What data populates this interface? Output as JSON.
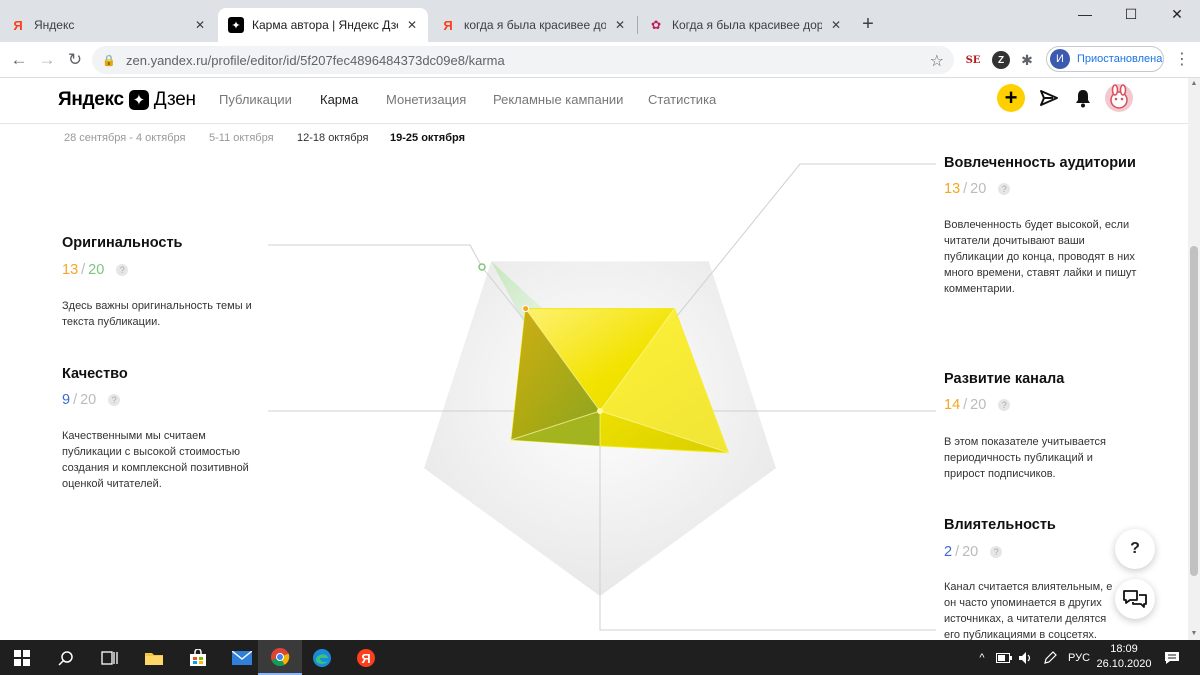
{
  "browser": {
    "tabs": [
      {
        "title": "Яндекс",
        "icon": "yandex-icon",
        "active": false
      },
      {
        "title": "Карма автора | Яндекс Дзен",
        "icon": "zen-icon",
        "active": true
      },
      {
        "title": "когда я была красивее дорама",
        "icon": "yandex-icon",
        "active": false
      },
      {
        "title": "Когда я была красивее дорама",
        "icon": "dorama-icon",
        "active": false
      }
    ],
    "url": "zen.yandex.ru/profile/editor/id/5f207fec4896484373dc09e8/karma",
    "profile_initial": "И",
    "profile_label": "Приостановлена",
    "ext_1": "SE"
  },
  "zen": {
    "logo_left": "Яндекс",
    "logo_right": "Дзен",
    "nav": [
      "Публикации",
      "Карма",
      "Монетизация",
      "Рекламные кампании",
      "Статистика"
    ],
    "active_nav": "Карма",
    "weeks": [
      "28 сентября - 4 октября",
      "5-11 октября",
      "12-18 октября",
      "19-25 октября"
    ],
    "selected_week": "19-25 октября"
  },
  "chart_data": {
    "type": "radar",
    "max": 20,
    "axes": [
      "Оригинальность",
      "Вовлеченность аудитории",
      "Развитие канала",
      "Влиятельность",
      "Качество"
    ],
    "values": [
      13,
      13,
      14,
      2,
      9
    ],
    "colors": {
      "fill": "#f6e600",
      "accent_green": "#7bc67b",
      "orange": "#f5a623",
      "blue": "#3a6ad6"
    }
  },
  "metrics": {
    "originality": {
      "title": "Оригинальность",
      "score": "13",
      "total": "20",
      "score_color": "#f5a623",
      "description": "Здесь важны оригинальность темы и текста публикации."
    },
    "quality": {
      "title": "Качество",
      "score": "9",
      "total": "20",
      "score_color": "#3a6ad6",
      "description": "Качественными мы считаем публикации с высокой стоимостью создания и комплексной позитивной оценкой читателей."
    },
    "engagement": {
      "title": "Вовлеченность аудитории",
      "score": "13",
      "total": "20",
      "score_color": "#f5a623",
      "description": "Вовлеченность будет высокой, если читатели дочитывают ваши публикации до конца, проводят в них много времени, ставят лайки и пишут комментарии."
    },
    "growth": {
      "title": "Развитие канала",
      "score": "14",
      "total": "20",
      "score_color": "#f5a623",
      "description": "В этом показателе учитывается периодичность публикаций и прирост подписчиков."
    },
    "influence": {
      "title": "Влиятельность",
      "score": "2",
      "total": "20",
      "score_color": "#3a6ad6",
      "description": "Канал считается влиятельным, е он часто упоминается в других источниках, а читатели делятся его публикациями в соцсетях."
    }
  },
  "help_label": "?",
  "taskbar": {
    "lang": "РУС",
    "time": "18:09",
    "date": "26.10.2020"
  }
}
